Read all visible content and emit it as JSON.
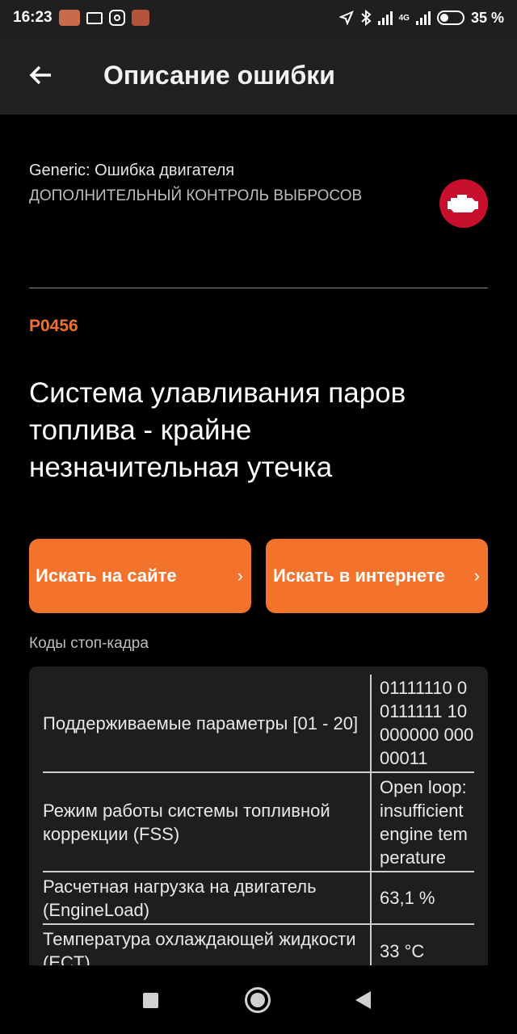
{
  "status": {
    "time": "16:23",
    "network": "4G",
    "battery": "35 %"
  },
  "appbar": {
    "title": "Описание ошибки"
  },
  "dtc": {
    "category": "Generic: Ошибка двигателя",
    "subcategory": "ДОПОЛНИТЕЛЬНЫЙ КОНТРОЛЬ ВЫБРОСОВ",
    "code": "P0456",
    "description": "Система улавливания паров топлива - крайне незначительная утечка"
  },
  "buttons": {
    "search_site": "Искать на сайте",
    "search_web": "Искать в интернете",
    "chevron": "›"
  },
  "freeze_frame": {
    "label": "Коды стоп-кадра",
    "rows": [
      {
        "name": "Поддерживаемые параметры [01 - 20]",
        "value": "01111110 00111111 10000000 00000011"
      },
      {
        "name": "Режим работы системы топливной коррекции (FSS)",
        "value": "Open loop: insufficient engine temperature"
      },
      {
        "name": "Расчетная нагрузка на двигатель (EngineLoad)",
        "value": "63,1 %"
      },
      {
        "name": "Температура охлаждающей жидкости (ECT)",
        "value": "33 °C"
      }
    ]
  },
  "colors": {
    "accent": "#f3732c",
    "code": "#f07030",
    "badge": "#c8102e"
  }
}
